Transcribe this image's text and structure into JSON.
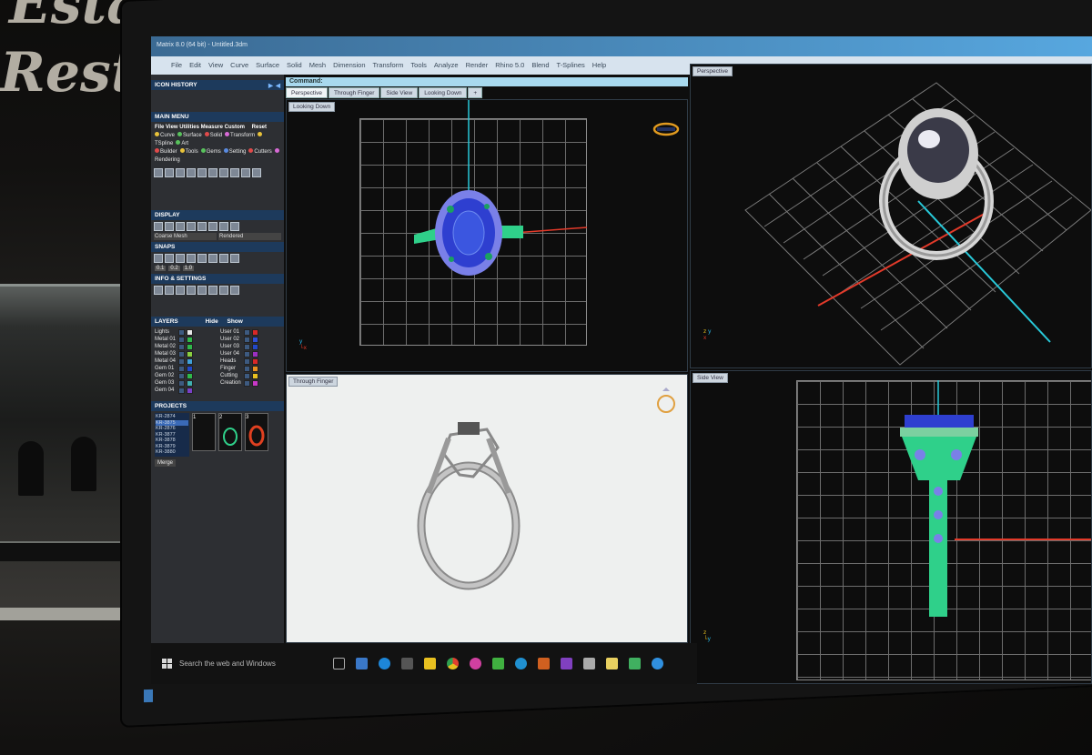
{
  "background": {
    "sign_line_1": "Estate",
    "sign_line_2": "Resto"
  },
  "app": {
    "title": "Matrix 8.0 (64 bit) - Untitled.3dm",
    "menu": [
      "File",
      "Edit",
      "View",
      "Curve",
      "Surface",
      "Solid",
      "Mesh",
      "Dimension",
      "Transform",
      "Tools",
      "Analyze",
      "Render",
      "Rhino 5.0",
      "Blend",
      "T-Splines",
      "Help"
    ]
  },
  "panel": {
    "icon_history": "ICON HISTORY",
    "main_menu": "MAIN MENU",
    "reset": "Reset",
    "mm_row1": [
      "File",
      "View",
      "Utilities",
      "Measure",
      "Custom"
    ],
    "mm_row2": [
      {
        "label": "Curve",
        "color": "#e8c23a"
      },
      {
        "label": "Surface",
        "color": "#58c15c"
      },
      {
        "label": "Solid",
        "color": "#e04a4a"
      },
      {
        "label": "Transform",
        "color": "#d86ad6"
      },
      {
        "label": "TSpline",
        "color": "#e8c23a"
      },
      {
        "label": "Art",
        "color": "#58c15c"
      }
    ],
    "mm_row3": [
      {
        "label": "Builder",
        "color": "#e04a4a"
      },
      {
        "label": "Tools",
        "color": "#e8c23a"
      },
      {
        "label": "Gems",
        "color": "#58c15c"
      },
      {
        "label": "Setting",
        "color": "#5a8be0"
      },
      {
        "label": "Cutters",
        "color": "#e04a4a"
      },
      {
        "label": "Rendering",
        "color": "#d86ad6"
      }
    ],
    "display": "DISPLAY",
    "display_mesh": "Coarse Mesh",
    "display_mode": "Rendered",
    "snaps": "SNAPS",
    "snap_val_1": "0.1",
    "snap_val_2": "0.2",
    "snap_val_3": "1.0",
    "info": "INFO & SETTINGS",
    "layers": "LAYERS",
    "hide": "Hide",
    "show": "Show",
    "layers_left": [
      {
        "name": "Lights",
        "color": "#e8e8e8"
      },
      {
        "name": "Metal 01",
        "color": "#2fb84a"
      },
      {
        "name": "Metal 02",
        "color": "#2fb84a"
      },
      {
        "name": "Metal 03",
        "color": "#8ad040"
      },
      {
        "name": "Metal 04",
        "color": "#40a0d8"
      },
      {
        "name": "Gem 01",
        "color": "#2248c8"
      },
      {
        "name": "Gem 02",
        "color": "#2fb84a"
      },
      {
        "name": "Gem 03",
        "color": "#40b0b0"
      },
      {
        "name": "Gem 04",
        "color": "#7a40c8"
      }
    ],
    "layers_right": [
      {
        "name": "User 01",
        "color": "#d82828"
      },
      {
        "name": "User 02",
        "color": "#3050d8"
      },
      {
        "name": "User 03",
        "color": "#2248c8"
      },
      {
        "name": "User 04",
        "color": "#9a30c0"
      },
      {
        "name": "Heads",
        "color": "#d82828"
      },
      {
        "name": "Finger",
        "color": "#e89020"
      },
      {
        "name": "Cutting",
        "color": "#e8c020"
      },
      {
        "name": "Creation",
        "color": "#c838c8"
      }
    ],
    "projects": "PROJECTS",
    "project_list": [
      "KR-2874",
      "KR-3875",
      "KR-2876",
      "KR-3877",
      "KR-3878",
      "KR-3879",
      "KR-3880"
    ],
    "thumb_nums": [
      "1",
      "2",
      "3"
    ],
    "merge": "Merge"
  },
  "command": {
    "label": "Command:"
  },
  "tabs": [
    "Perspective",
    "Through Finger",
    "Side View",
    "Looking Down"
  ],
  "viewports": {
    "top_left": "Looking Down",
    "bottom_left": "Through Finger",
    "top_right": "Perspective",
    "bottom_right": "Side View"
  },
  "axes": {
    "x": "x",
    "y": "y",
    "z": "z"
  },
  "taskbar": {
    "search": "Search the web and Windows"
  },
  "colors": {
    "accent": "#57a7df",
    "gem_blue": "#2e3fd0",
    "metal_green": "#2fd08a",
    "axis_red": "#e23a2a",
    "axis_cyan": "#28c8d8"
  }
}
